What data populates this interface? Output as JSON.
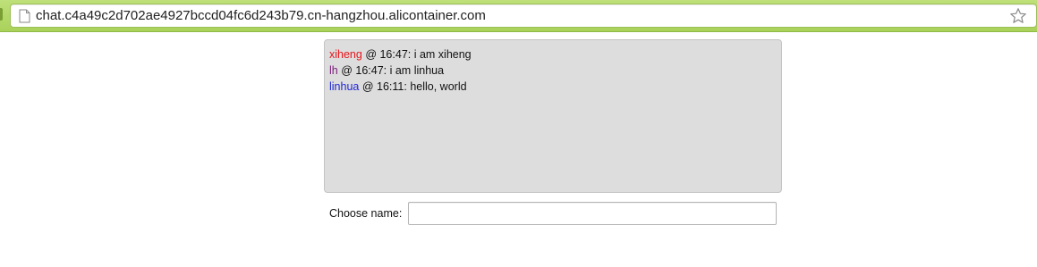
{
  "browser": {
    "url": "chat.c4a49c2d702ae4927bccd04fc6d243b79.cn-hangzhou.alicontainer.com",
    "page_icon": "page-icon",
    "bookmark_icon": "star-icon"
  },
  "chat": {
    "messages": [
      {
        "user": "xiheng",
        "user_color": "#e8151b",
        "separator": " @ ",
        "time": "16:47",
        "text": ": i am xiheng"
      },
      {
        "user": "lh",
        "user_color": "#7a1b7c",
        "separator": " @ ",
        "time": "16:47",
        "text": ": i am linhua"
      },
      {
        "user": "linhua",
        "user_color": "#1f26d6",
        "separator": " @ ",
        "time": "16:11",
        "text": ": hello, world"
      }
    ]
  },
  "name_form": {
    "label": "Choose name:",
    "value": "",
    "placeholder": ""
  },
  "colors": {
    "chrome": "#a9d25a",
    "chat_background": "#dddddd"
  }
}
